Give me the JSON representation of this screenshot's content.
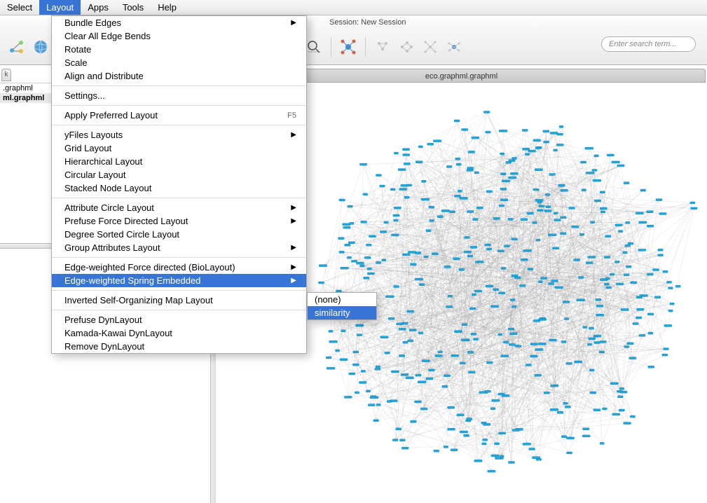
{
  "menubar": {
    "items": [
      "Select",
      "Layout",
      "Apps",
      "Tools",
      "Help"
    ],
    "active_index": 1
  },
  "session": {
    "label": "Session: New Session"
  },
  "search": {
    "placeholder": "Enter search term..."
  },
  "document": {
    "title": "eco.graphml.graphml"
  },
  "left_panel": {
    "tab": "k",
    "rows": [
      ".graphml",
      "ml.graphml"
    ]
  },
  "dropdown": {
    "groups": [
      {
        "items": [
          {
            "label": "Bundle Edges",
            "sub": true
          },
          {
            "label": "Clear All Edge Bends"
          },
          {
            "label": "Rotate"
          },
          {
            "label": "Scale"
          },
          {
            "label": "Align and Distribute"
          }
        ]
      },
      {
        "items": [
          {
            "label": "Settings..."
          }
        ]
      },
      {
        "items": [
          {
            "label": "Apply Preferred Layout",
            "shortcut": "F5"
          }
        ]
      },
      {
        "items": [
          {
            "label": "yFiles Layouts",
            "sub": true
          },
          {
            "label": "Grid Layout"
          },
          {
            "label": "Hierarchical Layout"
          },
          {
            "label": "Circular Layout"
          },
          {
            "label": "Stacked Node Layout"
          }
        ]
      },
      {
        "items": [
          {
            "label": "Attribute Circle Layout",
            "sub": true
          },
          {
            "label": "Prefuse Force Directed Layout",
            "sub": true
          },
          {
            "label": "Degree Sorted Circle Layout"
          },
          {
            "label": "Group Attributes Layout",
            "sub": true
          }
        ]
      },
      {
        "items": [
          {
            "label": "Edge-weighted Force directed (BioLayout)",
            "sub": true
          },
          {
            "label": "Edge-weighted Spring Embedded",
            "sub": true,
            "selected": true
          }
        ]
      },
      {
        "items": [
          {
            "label": "Inverted Self-Organizing Map Layout"
          }
        ]
      },
      {
        "items": [
          {
            "label": "Prefuse DynLayout"
          },
          {
            "label": "Kamada-Kawai DynLayout"
          },
          {
            "label": "Remove DynLayout"
          }
        ]
      }
    ]
  },
  "submenu": {
    "items": [
      {
        "label": "(none)"
      },
      {
        "label": "similarity",
        "selected": true
      }
    ]
  }
}
